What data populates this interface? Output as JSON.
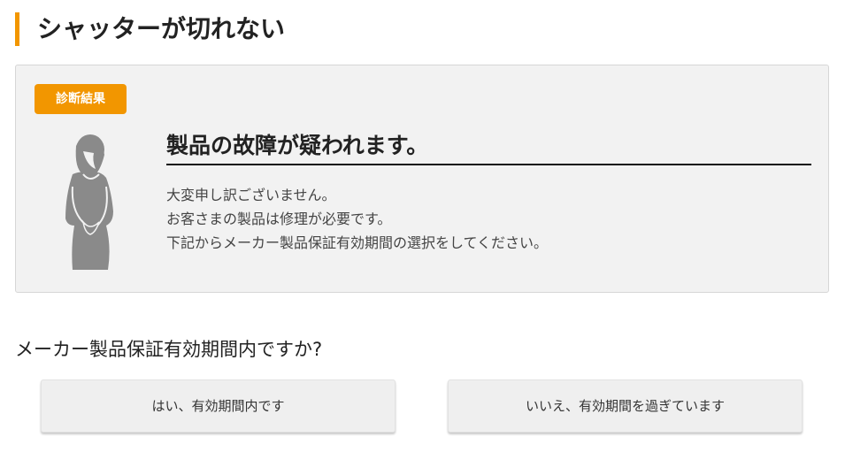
{
  "page": {
    "title": "シャッターが切れない"
  },
  "result": {
    "badge": "診断結果",
    "illustration_icon": "bowing-woman-icon",
    "headline": "製品の故障が疑われます。",
    "message_lines": [
      "大変申し訳ございません。",
      "お客さまの製品は修理が必要です。",
      "下記からメーカー製品保証有効期間の選択をしてください。"
    ]
  },
  "question": {
    "text": "メーカー製品保証有効期間内ですか?",
    "choices": [
      {
        "label": "はい、有効期間内です"
      },
      {
        "label": "いいえ、有効期間を過ぎています"
      }
    ]
  },
  "colors": {
    "accent": "#f29600",
    "box_background": "#f2f2f2",
    "illustration": "#8a8a8a"
  }
}
